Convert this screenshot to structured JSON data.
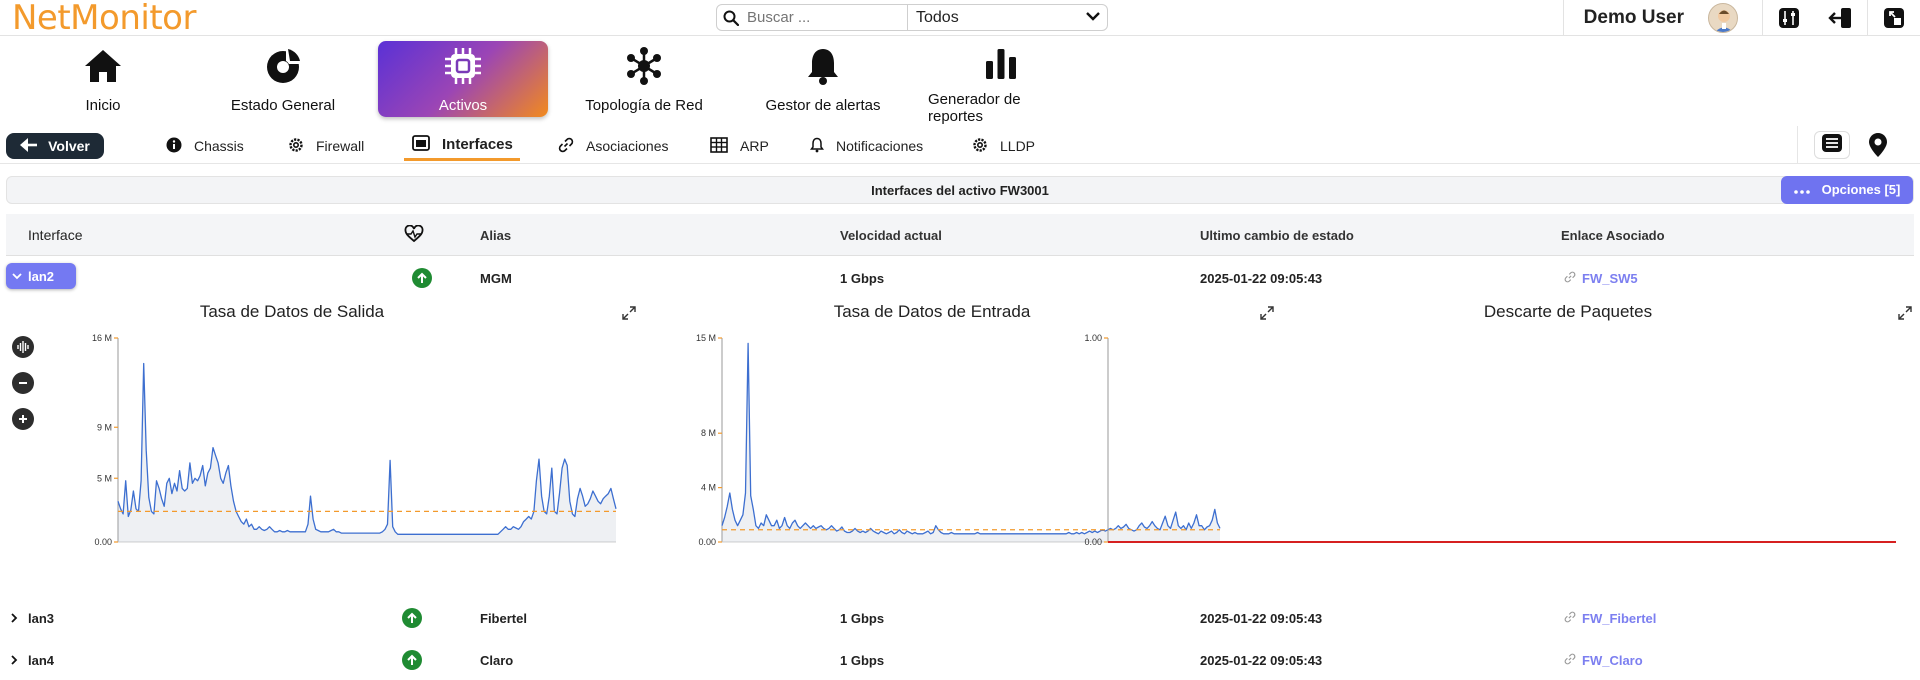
{
  "app": {
    "logo": "NetMonitor",
    "search_placeholder": "Buscar ...",
    "search_scope": "Todos",
    "user_name": "Demo User"
  },
  "nav": [
    {
      "label": "Inicio",
      "icon": "home-icon"
    },
    {
      "label": "Estado General",
      "icon": "donut-chart-icon"
    },
    {
      "label": "Activos",
      "icon": "chip-icon"
    },
    {
      "label": "Topología de Red",
      "icon": "network-icon"
    },
    {
      "label": "Gestor de alertas",
      "icon": "bell-icon"
    },
    {
      "label": "Generador de reportes",
      "icon": "bar-chart-icon"
    }
  ],
  "subnav": {
    "back_label": "Volver",
    "tabs": [
      {
        "label": "Chassis",
        "icon": "info-icon"
      },
      {
        "label": "Firewall",
        "icon": "gear-icon"
      },
      {
        "label": "Interfaces",
        "icon": "interface-icon"
      },
      {
        "label": "Asociaciones",
        "icon": "link-icon"
      },
      {
        "label": "ARP",
        "icon": "table-icon"
      },
      {
        "label": "Notificaciones",
        "icon": "bell-icon"
      },
      {
        "label": "LLDP",
        "icon": "gear-icon"
      }
    ]
  },
  "panel": {
    "title": "Interfaces del activo FW3001",
    "options_label": "Opciones [5]"
  },
  "table": {
    "headers": [
      "Interface",
      "",
      "Alias",
      "Velocidad actual",
      "Ultimo cambio de estado",
      "Enlace Asociado"
    ],
    "rows": [
      {
        "interface": "lan2",
        "status": "up",
        "alias": "MGM",
        "speed": "1 Gbps",
        "changed": "2025-01-22 09:05:43",
        "link": "FW_SW5"
      },
      {
        "interface": "lan3",
        "status": "up",
        "alias": "Fibertel",
        "speed": "1 Gbps",
        "changed": "2025-01-22 09:05:43",
        "link": "FW_Fibertel"
      },
      {
        "interface": "lan4",
        "status": "up",
        "alias": "Claro",
        "speed": "1 Gbps",
        "changed": "2025-01-22 09:05:43",
        "link": "FW_Claro"
      }
    ]
  },
  "colors": {
    "accent_orange": "#f39a2c",
    "accent_purple": "#7479f2",
    "status_green": "#1f8b32",
    "series_blue": "#3d6fd0",
    "avg_orange": "#f39a2c",
    "drop_red": "#d62020"
  },
  "chart_data": [
    {
      "type": "line",
      "title": "Tasa de Datos de Salida",
      "yticks": [
        "16 M",
        "9 M",
        "5 M",
        "0.00"
      ],
      "ytick_values": [
        16,
        9,
        5,
        0
      ],
      "ylim": [
        0,
        16
      ],
      "average": 2.4,
      "values": [
        3.2,
        2.6,
        2.2,
        4.8,
        2.0,
        2.5,
        4.0,
        2.6,
        2.4,
        4.8,
        14.0,
        7.2,
        3.5,
        2.4,
        2.2,
        4.8,
        4.2,
        3.4,
        2.8,
        4.6,
        5.0,
        3.8,
        4.6,
        4.0,
        5.6,
        4.2,
        4.0,
        4.2,
        6.2,
        4.6,
        5.0,
        4.8,
        5.2,
        6.0,
        4.4,
        5.4,
        5.8,
        7.4,
        6.8,
        6.2,
        5.0,
        4.6,
        5.4,
        6.0,
        4.4,
        3.2,
        2.4,
        2.0,
        1.6,
        1.4,
        1.8,
        1.2,
        1.4,
        1.0,
        1.0,
        1.2,
        1.0,
        0.9,
        1.0,
        1.2,
        1.0,
        0.8,
        0.8,
        0.9,
        0.8,
        0.8,
        0.9,
        0.8,
        0.8,
        0.8,
        0.8,
        0.8,
        0.8,
        0.8,
        1.4,
        3.6,
        1.8,
        1.0,
        0.9,
        0.8,
        0.8,
        0.8,
        0.8,
        0.9,
        1.0,
        0.8,
        0.8,
        0.7,
        0.7,
        0.7,
        0.7,
        0.7,
        0.7,
        0.7,
        0.7,
        0.7,
        0.7,
        0.7,
        0.7,
        0.7,
        0.7,
        0.7,
        0.7,
        0.8,
        1.0,
        1.4,
        6.4,
        1.2,
        0.8,
        0.6,
        0.6,
        0.6,
        0.6,
        0.6,
        0.6,
        0.6,
        0.6,
        0.6,
        0.6,
        0.6,
        0.6,
        0.6,
        0.6,
        0.6,
        0.6,
        0.6,
        0.6,
        0.6,
        0.6,
        0.6,
        0.6,
        0.6,
        0.6,
        0.6,
        0.6,
        0.6,
        0.6,
        0.6,
        0.6,
        0.6,
        0.6,
        0.6,
        0.6,
        0.6,
        0.6,
        0.6,
        0.6,
        0.6,
        0.6,
        0.8,
        1.0,
        1.2,
        1.0,
        1.0,
        1.2,
        1.1,
        1.0,
        1.2,
        1.6,
        1.8,
        2.0,
        1.8,
        2.4,
        4.8,
        6.5,
        3.6,
        2.4,
        2.2,
        3.6,
        5.8,
        2.4,
        2.2,
        3.8,
        5.8,
        6.5,
        6.0,
        3.2,
        2.2,
        2.0,
        3.4,
        4.2,
        3.6,
        2.8,
        3.0,
        3.4,
        4.0,
        3.6,
        3.2,
        3.0,
        3.4,
        3.6,
        3.8,
        4.2,
        3.4,
        2.6
      ]
    },
    {
      "type": "line",
      "title": "Tasa de Datos de Entrada",
      "yticks": [
        "15 M",
        "8 M",
        "4 M",
        "0.00"
      ],
      "ytick_values": [
        15,
        8,
        4,
        0
      ],
      "ylim": [
        0,
        15
      ],
      "average": 0.9,
      "values": [
        1.2,
        1.8,
        2.6,
        3.6,
        2.4,
        1.6,
        1.2,
        1.6,
        2.0,
        3.6,
        14.6,
        3.4,
        2.4,
        1.2,
        1.0,
        1.4,
        1.2,
        2.0,
        1.6,
        1.2,
        1.2,
        1.6,
        1.0,
        1.2,
        1.8,
        1.2,
        1.0,
        1.4,
        1.6,
        1.2,
        1.0,
        1.2,
        1.4,
        1.2,
        1.0,
        1.2,
        1.0,
        1.1,
        1.2,
        1.0,
        0.9,
        1.0,
        1.2,
        1.0,
        0.8,
        0.9,
        1.1,
        0.8,
        0.7,
        0.7,
        0.8,
        1.0,
        0.8,
        0.7,
        0.8,
        0.7,
        0.8,
        1.0,
        0.8,
        0.7,
        0.6,
        0.8,
        0.7,
        0.6,
        0.7,
        0.8,
        0.6,
        0.7,
        0.9,
        0.7,
        0.6,
        0.8,
        0.7,
        0.6,
        0.7,
        0.6,
        0.6,
        0.6,
        0.7,
        0.8,
        0.6,
        0.7,
        1.2,
        0.9,
        0.7,
        0.6,
        0.6,
        0.6,
        0.7,
        0.6,
        0.6,
        0.6,
        0.6,
        0.6,
        0.6,
        0.6,
        0.6,
        0.6,
        0.7,
        0.6,
        0.6,
        0.6,
        0.6,
        0.6,
        0.6,
        0.6,
        0.6,
        0.6,
        0.6,
        0.6,
        0.6,
        0.6,
        0.6,
        0.6,
        0.6,
        0.6,
        0.6,
        0.6,
        0.6,
        0.6,
        0.6,
        0.6,
        0.6,
        0.6,
        0.6,
        0.6,
        0.6,
        0.6,
        0.6,
        0.6,
        0.6,
        0.6,
        0.6,
        0.7,
        0.6,
        0.6,
        0.7,
        0.6,
        0.7,
        0.6,
        0.7,
        0.8,
        0.7,
        0.8,
        0.7,
        0.8,
        0.9,
        0.8,
        0.9,
        1.0,
        0.9,
        1.0,
        1.2,
        1.0,
        1.1,
        1.3,
        1.0,
        0.9,
        0.8,
        0.9,
        1.2,
        1.4,
        1.1,
        1.0,
        1.2,
        1.5,
        1.2,
        1.0,
        0.9,
        1.4,
        1.9,
        1.2,
        1.0,
        1.6,
        2.2,
        1.2,
        1.0,
        1.2,
        0.9,
        1.4,
        1.0,
        1.4,
        2.0,
        1.2,
        1.2,
        0.9,
        1.1,
        1.2,
        1.6,
        2.4,
        1.4,
        1.0
      ]
    },
    {
      "type": "line",
      "title": "Descarte de Paquetes",
      "yticks": [
        "1.00",
        "0.00"
      ],
      "ytick_values": [
        1,
        0
      ],
      "ylim": [
        0,
        1
      ],
      "average": 0,
      "values": [
        0,
        0,
        0,
        0,
        0,
        0,
        0,
        0,
        0,
        0,
        0,
        0,
        0,
        0,
        0,
        0,
        0,
        0,
        0,
        0
      ]
    }
  ]
}
